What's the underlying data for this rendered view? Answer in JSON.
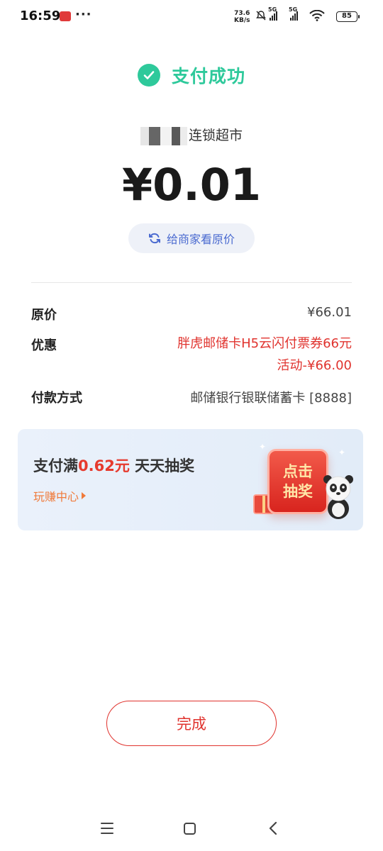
{
  "status_bar": {
    "time": "16:59",
    "more": "···",
    "net_speed_value": "73.6",
    "net_speed_unit": "KB/s",
    "sim1_label": "5G",
    "sim2_label": "5G",
    "battery": "85"
  },
  "header": {
    "success_text": "支付成功",
    "accent_color": "#2ec99b"
  },
  "merchant": {
    "name_suffix": "连锁超市"
  },
  "payment": {
    "amount": "¥0.01",
    "view_original_label": "给商家看原价"
  },
  "details": {
    "original_price_label": "原价",
    "original_price_value": "¥66.01",
    "discount_label": "优惠",
    "discount_line1": "胖虎邮储卡H5云闪付票券66元",
    "discount_line2": "活动-¥66.00",
    "payment_method_label": "付款方式",
    "payment_method_value": "邮储银行银联储蓄卡 [8888]"
  },
  "promo": {
    "title_prefix": "支付满",
    "title_amount": "0.62元",
    "title_suffix": " 天天抽奖",
    "link_label": "玩赚中心",
    "button_line1": "点击",
    "button_line2": "抽奖"
  },
  "actions": {
    "done_label": "完成",
    "accent_color": "#e0332e"
  }
}
